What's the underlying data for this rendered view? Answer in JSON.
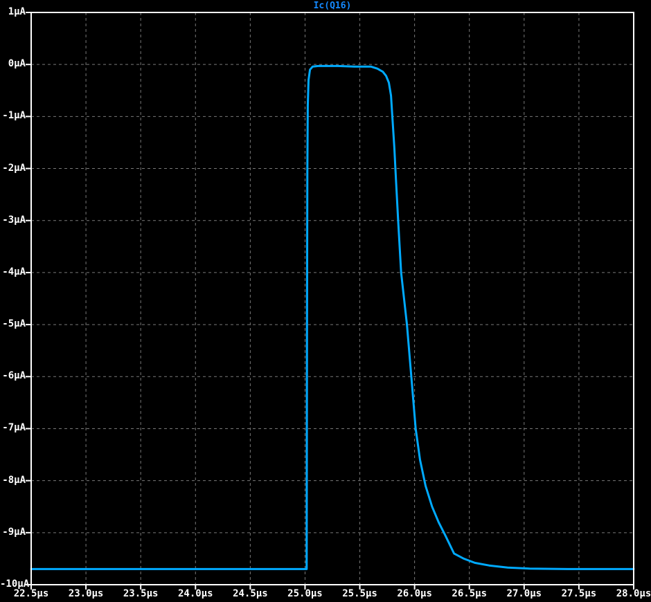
{
  "window": {
    "background_color": "#000000",
    "border_color": "#ffffff"
  },
  "chart_data": {
    "type": "line",
    "title": "Ic(Q16)",
    "title_color": "#1489ff",
    "trace_color": "#00aaff",
    "grid_color": "#7a7a7a",
    "axis_color": "#ffffff",
    "label_color": "#ffffff",
    "xlabel": "",
    "ylabel": "",
    "x_unit": "µs",
    "y_unit": "µA",
    "xlim": [
      22.5,
      28.0
    ],
    "ylim": [
      -10,
      1
    ],
    "x_tick_step": 0.5,
    "y_tick_step": 1,
    "grid": "dashed",
    "legend_position": "top-center-title",
    "x_tick_labels": [
      "22.5µs",
      "23.0µs",
      "23.5µs",
      "24.0µs",
      "24.5µs",
      "25.0µs",
      "25.5µs",
      "26.0µs",
      "26.5µs",
      "27.0µs",
      "27.5µs",
      "28.0µs"
    ],
    "y_tick_labels": [
      "1µA",
      "0µA",
      "-1µA",
      "-2µA",
      "-3µA",
      "-4µA",
      "-5µA",
      "-6µA",
      "-7µA",
      "-8µA",
      "-9µA",
      "-10µA"
    ],
    "series": [
      {
        "name": "Ic(Q16)",
        "color": "#00aaff",
        "points": [
          [
            22.5,
            -9.7
          ],
          [
            24.0,
            -9.7
          ],
          [
            25.015,
            -9.7
          ],
          [
            25.018,
            -5.0
          ],
          [
            25.021,
            -2.0
          ],
          [
            25.025,
            -0.8
          ],
          [
            25.032,
            -0.3
          ],
          [
            25.045,
            -0.1
          ],
          [
            25.07,
            -0.04
          ],
          [
            25.12,
            -0.03
          ],
          [
            25.3,
            -0.03
          ],
          [
            25.45,
            -0.04
          ],
          [
            25.6,
            -0.04
          ],
          [
            25.66,
            -0.08
          ],
          [
            25.71,
            -0.14
          ],
          [
            25.74,
            -0.22
          ],
          [
            25.765,
            -0.35
          ],
          [
            25.785,
            -0.6
          ],
          [
            25.797,
            -1.0
          ],
          [
            25.815,
            -1.6
          ],
          [
            25.83,
            -2.2
          ],
          [
            25.85,
            -3.0
          ],
          [
            25.877,
            -4.0
          ],
          [
            25.93,
            -5.0
          ],
          [
            25.97,
            -6.0
          ],
          [
            26.01,
            -7.0
          ],
          [
            26.05,
            -7.6
          ],
          [
            26.1,
            -8.1
          ],
          [
            26.16,
            -8.5
          ],
          [
            26.22,
            -8.8
          ],
          [
            26.28,
            -9.05
          ],
          [
            26.36,
            -9.4
          ],
          [
            26.45,
            -9.5
          ],
          [
            26.55,
            -9.58
          ],
          [
            26.68,
            -9.63
          ],
          [
            26.85,
            -9.67
          ],
          [
            27.05,
            -9.69
          ],
          [
            27.4,
            -9.7
          ],
          [
            28.0,
            -9.7
          ]
        ]
      }
    ]
  }
}
